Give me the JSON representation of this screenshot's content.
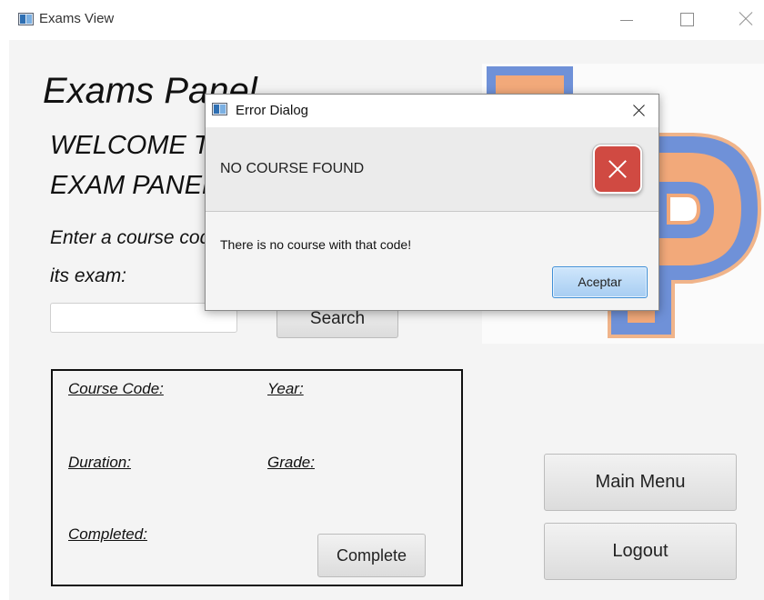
{
  "window": {
    "title": "Exams View"
  },
  "main": {
    "panel_title": "Exams Panel",
    "welcome_line1": "WELCOME TO THE",
    "welcome_line2": "EXAM PANEL",
    "prompt_line1": "Enter a course code to see",
    "prompt_line2": "its exam:",
    "search_value": "",
    "search_label": "Search",
    "info": {
      "course_code_label": "Course Code:",
      "year_label": "Year:",
      "duration_label": "Duration:",
      "grade_label": "Grade:",
      "completed_label": "Completed:",
      "complete_label": "Complete"
    },
    "main_menu_label": "Main Menu",
    "logout_label": "Logout"
  },
  "dialog": {
    "title": "Error Dialog",
    "header": "NO COURSE FOUND",
    "content": "There is no course with that code!",
    "ok_label": "Aceptar",
    "icon": "error-icon",
    "accent": "#d04a42"
  },
  "colors": {
    "logo_orange": "#f2a97a",
    "logo_blue": "#6f91d8",
    "dialog_button": "#a7cdf2"
  }
}
